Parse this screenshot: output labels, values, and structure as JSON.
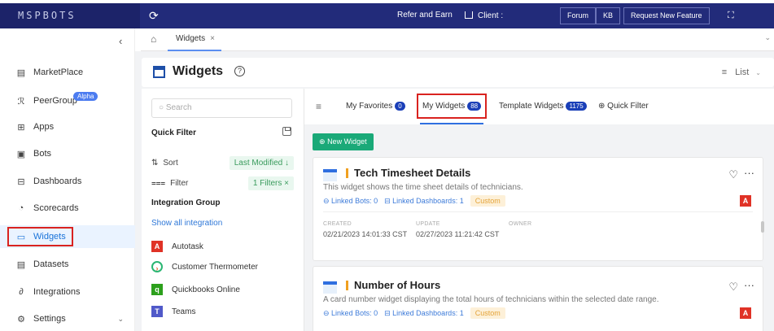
{
  "topbar": {
    "logo": "MSPBOTS",
    "refer": "Refer and Earn",
    "client": "Client :",
    "buttons": [
      "Forum",
      "KB",
      "Request New Feature"
    ],
    "accent": "#222b7a"
  },
  "sidebar": {
    "collapse_icon": "chevron-left-icon",
    "items": [
      {
        "label": "MarketPlace",
        "icon": "store-icon"
      },
      {
        "label": "PeerGroup",
        "icon": "peer-icon",
        "badge": "Alpha"
      },
      {
        "label": "Apps",
        "icon": "apps-icon"
      },
      {
        "label": "Bots",
        "icon": "bot-icon"
      },
      {
        "label": "Dashboards",
        "icon": "dashboard-icon"
      },
      {
        "label": "Scorecards",
        "icon": "scorecard-icon"
      },
      {
        "label": "Widgets",
        "icon": "widget-icon",
        "active": true
      },
      {
        "label": "Datasets",
        "icon": "dataset-icon"
      },
      {
        "label": "Integrations",
        "icon": "integration-icon"
      },
      {
        "label": "Settings",
        "icon": "gear-icon"
      }
    ]
  },
  "tabstrip": {
    "tab": "Widgets",
    "close": "×"
  },
  "page": {
    "title": "Widgets",
    "help": "?",
    "view": "List"
  },
  "filter": {
    "search_placeholder": "Search",
    "quick_filter": "Quick Filter",
    "sort_label": "Sort",
    "sort_value": "Last Modified ↓",
    "filter_label": "Filter",
    "filter_value": "1 Filters ×",
    "integration_group": "Integration Group",
    "show_all": "Show all integration",
    "integrations": [
      "Autotask",
      "Customer Thermometer",
      "Quickbooks Online",
      "Teams"
    ]
  },
  "widgets_tabs": [
    {
      "label": "My Favorites",
      "count": "0"
    },
    {
      "label": "My Widgets",
      "count": "88",
      "active": true
    },
    {
      "label": "Template Widgets",
      "count": "1175"
    },
    {
      "label": "Quick Filter"
    }
  ],
  "new_widget": "New Widget",
  "cards": [
    {
      "title": "Tech Timesheet Details",
      "description": "This widget shows the time sheet details of technicians.",
      "linked_bots": "Linked Bots: 0",
      "linked_dashboards": "Linked Dashboards: 1",
      "tag": "Custom",
      "created_label": "CREATED",
      "created": "02/21/2023 14:01:33 CST",
      "update_label": "UPDATE",
      "updated": "02/27/2023 11:21:42 CST",
      "owner_label": "OWNER"
    },
    {
      "title": "Number of Hours",
      "description": "A card number widget displaying the total hours of technicians within the selected date range.",
      "linked_bots": "Linked Bots: 0",
      "linked_dashboards": "Linked Dashboards: 1",
      "tag": "Custom"
    }
  ]
}
